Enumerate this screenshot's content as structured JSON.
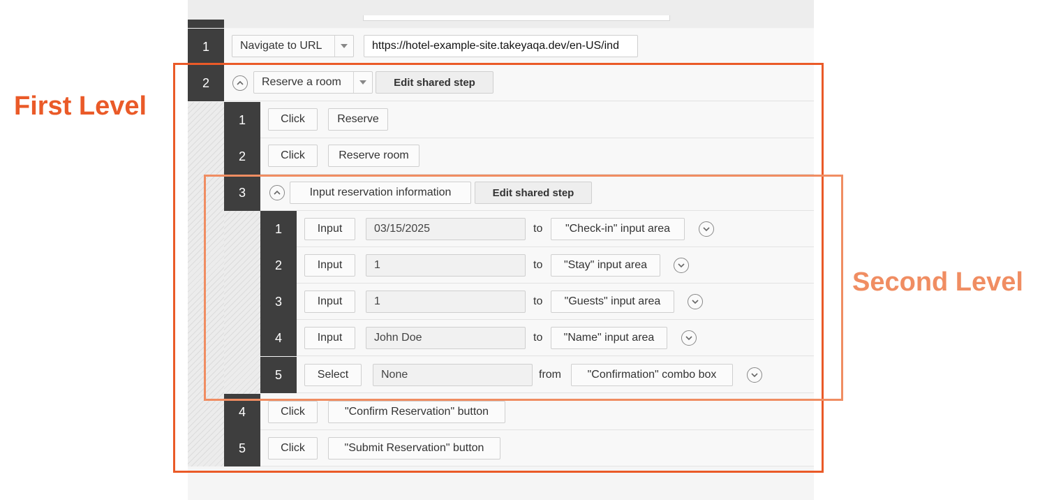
{
  "steps": {
    "s1": {
      "num": "1",
      "action": "Navigate to URL",
      "url": "https://hotel-example-site.takeyaqa.dev/en-US/ind"
    },
    "s2": {
      "num": "2",
      "action": "Reserve a room",
      "edit_label": "Edit shared step"
    },
    "s2_1": {
      "num": "1",
      "action": "Click",
      "target": "Reserve"
    },
    "s2_2": {
      "num": "2",
      "action": "Click",
      "target": "Reserve room"
    },
    "s2_3": {
      "num": "3",
      "action": "Input reservation information",
      "edit_label": "Edit shared step"
    },
    "s2_3_1": {
      "num": "1",
      "action": "Input",
      "value": "03/15/2025",
      "connector": "to",
      "target": "\"Check-in\" input area"
    },
    "s2_3_2": {
      "num": "2",
      "action": "Input",
      "value": "1",
      "connector": "to",
      "target": "\"Stay\" input area"
    },
    "s2_3_3": {
      "num": "3",
      "action": "Input",
      "value": "1",
      "connector": "to",
      "target": "\"Guests\" input area"
    },
    "s2_3_4": {
      "num": "4",
      "action": "Input",
      "value": "John Doe",
      "connector": "to",
      "target": "\"Name\" input area"
    },
    "s2_3_5": {
      "num": "5",
      "action": "Select",
      "value": "None",
      "connector": "from",
      "target": "\"Confirmation\" combo box"
    },
    "s2_4": {
      "num": "4",
      "action": "Click",
      "target": "\"Confirm Reservation\" button"
    },
    "s2_5": {
      "num": "5",
      "action": "Click",
      "target": "\"Submit Reservation\" button"
    }
  },
  "annotations": {
    "first_level": "First Level",
    "second_level": "Second Level"
  },
  "colors": {
    "first_level": "#ea5a28",
    "second_level": "#f08d62",
    "step_number_bg": "#3e3e3e"
  },
  "icons": {
    "collapse": "chevron-up-icon",
    "expand": "chevron-down-icon",
    "dropdown": "dropdown-arrow-icon"
  }
}
